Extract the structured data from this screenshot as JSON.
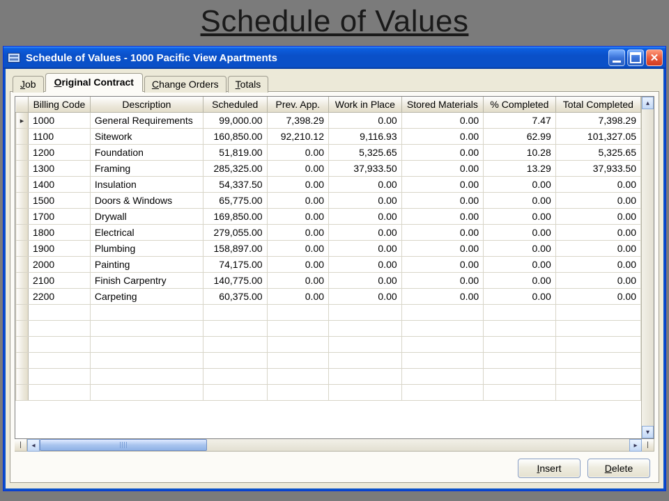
{
  "slide_title": "Schedule of Values",
  "window_title": "Schedule of Values - 1000   Pacific View Apartments",
  "tabs": [
    {
      "label": "Job",
      "mn": "J",
      "rest": "ob"
    },
    {
      "label": "Original Contract",
      "mn": "O",
      "rest": "riginal Contract"
    },
    {
      "label": "Change Orders",
      "mn": "C",
      "rest": "hange Orders"
    },
    {
      "label": "Totals",
      "mn": "T",
      "rest": "otals"
    }
  ],
  "active_tab_index": 1,
  "columns": [
    "Billing Code",
    "Description",
    "Scheduled",
    "Prev. App.",
    "Work in Place",
    "Stored Materials",
    "% Completed",
    "Total Completed"
  ],
  "rows": [
    {
      "code": "1000",
      "desc": "General Requirements",
      "sched": "99,000.00",
      "prev": "7,398.29",
      "wip": "0.00",
      "stored": "0.00",
      "pct": "7.47",
      "total": "7,398.29"
    },
    {
      "code": "1100",
      "desc": "Sitework",
      "sched": "160,850.00",
      "prev": "92,210.12",
      "wip": "9,116.93",
      "stored": "0.00",
      "pct": "62.99",
      "total": "101,327.05"
    },
    {
      "code": "1200",
      "desc": "Foundation",
      "sched": "51,819.00",
      "prev": "0.00",
      "wip": "5,325.65",
      "stored": "0.00",
      "pct": "10.28",
      "total": "5,325.65"
    },
    {
      "code": "1300",
      "desc": "Framing",
      "sched": "285,325.00",
      "prev": "0.00",
      "wip": "37,933.50",
      "stored": "0.00",
      "pct": "13.29",
      "total": "37,933.50"
    },
    {
      "code": "1400",
      "desc": "Insulation",
      "sched": "54,337.50",
      "prev": "0.00",
      "wip": "0.00",
      "stored": "0.00",
      "pct": "0.00",
      "total": "0.00"
    },
    {
      "code": "1500",
      "desc": "Doors & Windows",
      "sched": "65,775.00",
      "prev": "0.00",
      "wip": "0.00",
      "stored": "0.00",
      "pct": "0.00",
      "total": "0.00"
    },
    {
      "code": "1700",
      "desc": "Drywall",
      "sched": "169,850.00",
      "prev": "0.00",
      "wip": "0.00",
      "stored": "0.00",
      "pct": "0.00",
      "total": "0.00"
    },
    {
      "code": "1800",
      "desc": "Electrical",
      "sched": "279,055.00",
      "prev": "0.00",
      "wip": "0.00",
      "stored": "0.00",
      "pct": "0.00",
      "total": "0.00"
    },
    {
      "code": "1900",
      "desc": "Plumbing",
      "sched": "158,897.00",
      "prev": "0.00",
      "wip": "0.00",
      "stored": "0.00",
      "pct": "0.00",
      "total": "0.00"
    },
    {
      "code": "2000",
      "desc": "Painting",
      "sched": "74,175.00",
      "prev": "0.00",
      "wip": "0.00",
      "stored": "0.00",
      "pct": "0.00",
      "total": "0.00"
    },
    {
      "code": "2100",
      "desc": "Finish Carpentry",
      "sched": "140,775.00",
      "prev": "0.00",
      "wip": "0.00",
      "stored": "0.00",
      "pct": "0.00",
      "total": "0.00"
    },
    {
      "code": "2200",
      "desc": "Carpeting",
      "sched": "60,375.00",
      "prev": "0.00",
      "wip": "0.00",
      "stored": "0.00",
      "pct": "0.00",
      "total": "0.00"
    }
  ],
  "empty_row_count": 6,
  "buttons": {
    "insert": {
      "mn": "I",
      "rest": "nsert"
    },
    "delete": {
      "mn": "D",
      "rest": "elete"
    }
  }
}
